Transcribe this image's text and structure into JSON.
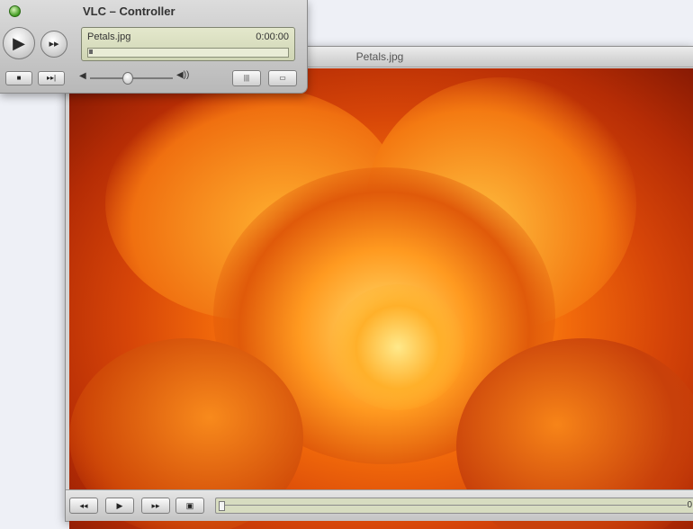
{
  "controller": {
    "title": "VLC – Controller",
    "play_icon": "▶",
    "fast_forward_icon": "▸▸",
    "file_name": "Petals.jpg",
    "time": "0:00:00",
    "playback_progress": 0.0,
    "stop_icon": "■",
    "next_icon": "▸▸|",
    "volume_low_icon": "◀",
    "volume_high_icon": "◀))",
    "volume_level": 0.45,
    "playlist_icon": "|||",
    "fullscreen_icon": "▭"
  },
  "video": {
    "title": "Petals.jpg",
    "rewind_icon": "◂◂",
    "play_icon": "▶",
    "forward_icon": "▸▸",
    "fullscreen_icon": "▣",
    "time_end": "0",
    "playback_progress": 0.0
  },
  "icons": {
    "play": "play-icon",
    "fast_forward": "fast-forward-icon",
    "stop": "stop-icon",
    "next": "next-track-icon",
    "volume": "speaker-icon",
    "playlist": "playlist-icon",
    "fullscreen": "fullscreen-icon"
  },
  "colors": {
    "lcd": "#d8ddbe",
    "chrome": "#c8c8c8",
    "rose_light": "#ffd24a",
    "rose_dark": "#7e1603"
  }
}
